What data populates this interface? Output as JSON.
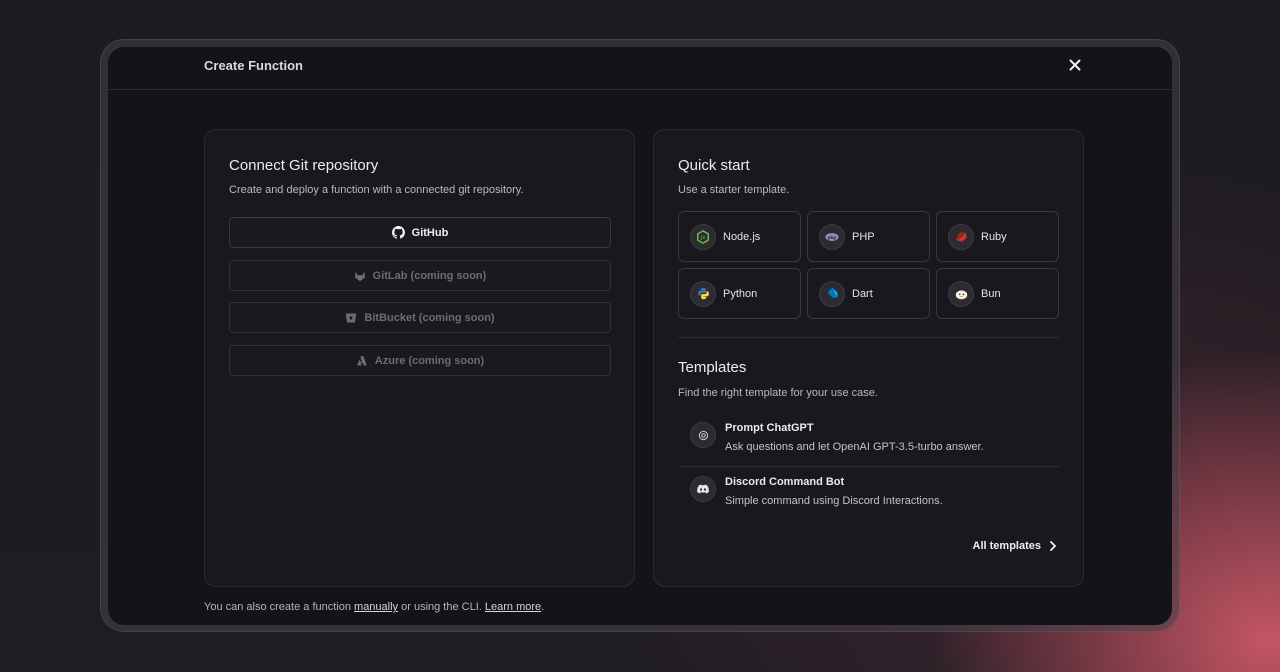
{
  "modal": {
    "title": "Create Function",
    "close_icon": "close-icon"
  },
  "git": {
    "title": "Connect Git repository",
    "subtitle": "Create and deploy a function with a connected git repository.",
    "providers": [
      {
        "label": "GitHub",
        "icon": "github-icon",
        "enabled": true
      },
      {
        "label": "GitLab (coming soon)",
        "icon": "gitlab-icon",
        "enabled": false
      },
      {
        "label": "BitBucket (coming soon)",
        "icon": "bitbucket-icon",
        "enabled": false
      },
      {
        "label": "Azure (coming soon)",
        "icon": "azure-icon",
        "enabled": false
      }
    ]
  },
  "quickstart": {
    "title": "Quick start",
    "subtitle": "Use a starter template.",
    "runtimes": [
      {
        "label": "Node.js",
        "icon": "nodejs-icon",
        "color": "#6cc24a"
      },
      {
        "label": "PHP",
        "icon": "php-icon",
        "color": "#8993be"
      },
      {
        "label": "Ruby",
        "icon": "ruby-icon",
        "color": "#cc342d"
      },
      {
        "label": "Python",
        "icon": "python-icon",
        "color": "#3776ab"
      },
      {
        "label": "Dart",
        "icon": "dart-icon",
        "color": "#0175c2"
      },
      {
        "label": "Bun",
        "icon": "bun-icon",
        "color": "#fbf0df"
      }
    ]
  },
  "templates": {
    "title": "Templates",
    "subtitle": "Find the right template for your use case.",
    "items": [
      {
        "name": "Prompt ChatGPT",
        "description": "Ask questions and let OpenAI GPT-3.5-turbo answer.",
        "icon": "openai-icon"
      },
      {
        "name": "Discord Command Bot",
        "description": "Simple command using Discord Interactions.",
        "icon": "discord-icon"
      }
    ],
    "all_label": "All templates"
  },
  "footer": {
    "prefix": "You can also create a function ",
    "manually": "manually",
    "middle": " or using the CLI. ",
    "learn_more": "Learn more",
    "suffix": "."
  }
}
